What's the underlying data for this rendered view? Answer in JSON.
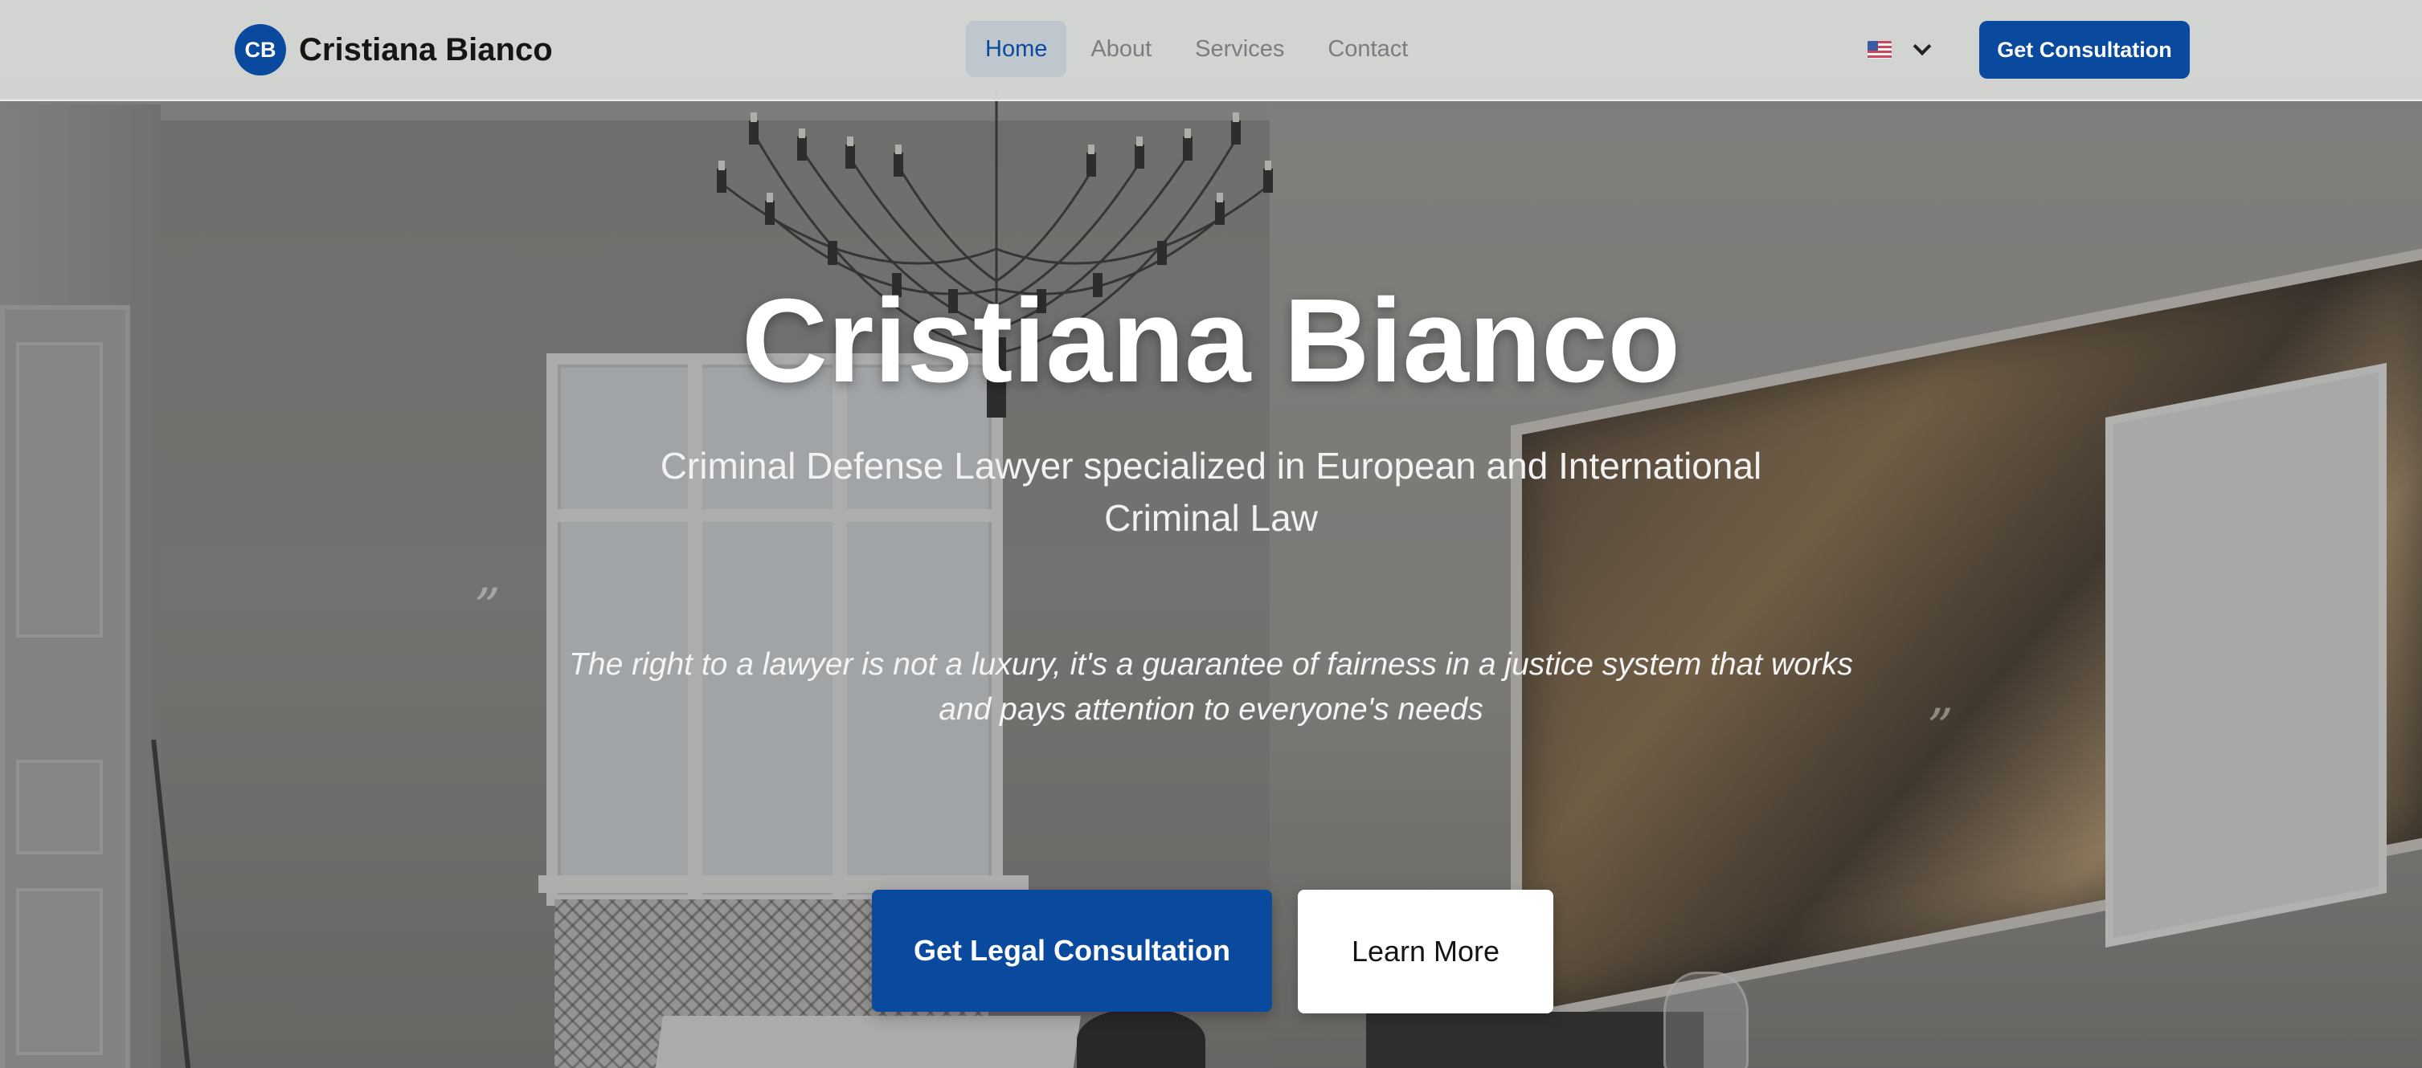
{
  "header": {
    "logo_initials": "CB",
    "logo_name": "Cristiana Bianco",
    "nav": [
      {
        "label": "Home",
        "active": true
      },
      {
        "label": "About",
        "active": false
      },
      {
        "label": "Services",
        "active": false
      },
      {
        "label": "Contact",
        "active": false
      }
    ],
    "language_flag": "us-flag-icon",
    "cta_label": "Get Consultation"
  },
  "hero": {
    "title": "Cristiana Bianco",
    "subtitle": "Criminal Defense Lawyer specialized in European and International Criminal Law",
    "quote_open_mark": "”",
    "quote_close_mark": "”",
    "quote": "The right to a lawyer is not a luxury, it's a guarantee of fairness in a justice system that works and pays attention to everyone's needs",
    "primary_button": "Get Legal Consultation",
    "secondary_button": "Learn More"
  },
  "colors": {
    "brand_blue": "#0a4a9e",
    "white": "#ffffff"
  }
}
